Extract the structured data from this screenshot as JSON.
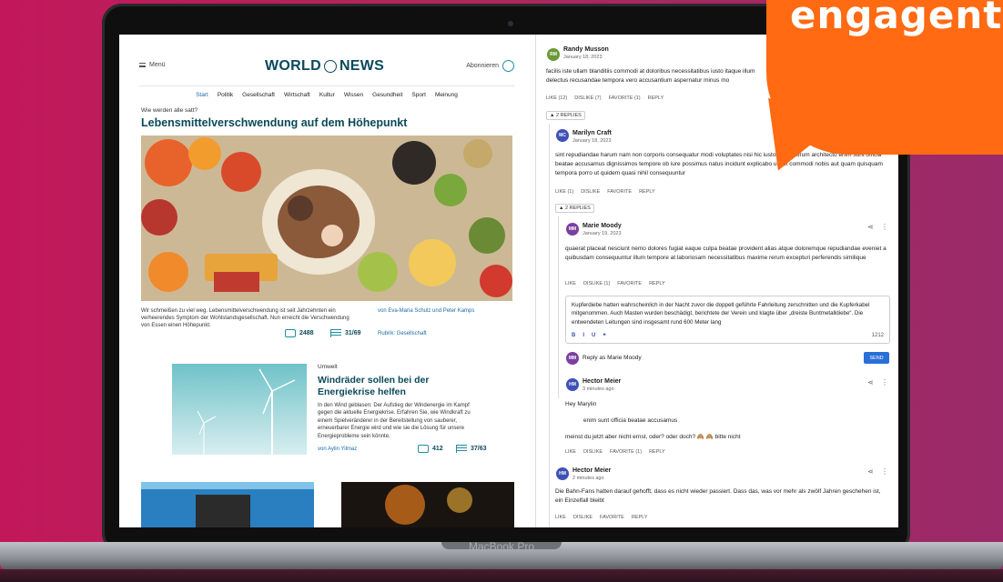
{
  "brand": {
    "bubble_text": "engagent",
    "device": "MacBook Pro",
    "accent": "#ff6a13"
  },
  "news": {
    "menu": "Menü",
    "logo_left": "WORLD",
    "logo_right": "NEWS",
    "subscribe": "Abonnieren",
    "nav": [
      "Start",
      "Politik",
      "Gesellschaft",
      "Wirtschaft",
      "Kultur",
      "Wissen",
      "Gesundheit",
      "Sport",
      "Meinung"
    ],
    "lead": {
      "kicker": "Wie werden alle satt?",
      "title": "Lebensmittelverschwendung auf dem Höhepunkt",
      "caption": "Wir schmeißen zu viel weg. Lebensmittelverschwendung ist seit Jahrzehnten ein verheerendes Symptom der Wohlstandsgesellschaft. Nun erreicht die Ver­schwendung von Essen einen Höhepunkt.",
      "authors": "von Eva-Maria Schulz und Peter Kamps",
      "rubric": "Rubrik: Gesellschaft",
      "comments": "2488",
      "reads": "31/69"
    },
    "second": {
      "kicker": "Umwelt",
      "title": "Windräder sollen bei der Energiekrise helfen",
      "text": "In den Wind geblasen: Der Aufstieg der Windenergie im Kampf gegen die aktuelle Energiekrise. Erfahren Sie, wie Windkraft zu einem Spielveränderer in der Bereitstellung von sauberer, erneuerbarer Energie wird und wie sie die Lösung für unsere Energieprobleme sein könnte.",
      "author": "von Aylin Yilmaz",
      "comments": "412",
      "reads": "37/63"
    }
  },
  "comments": {
    "c1": {
      "initials": "RM",
      "name": "Randy Musson",
      "date": "January 18, 2023",
      "text": "facilis iste ullam blanditiis commodi at doloribus necessitatibus iusto itaque illum delectus recusandae tempora vero accusantium aspernatur minus mo",
      "like": "LIKE (12)",
      "dislike": "DISLIKE (7)",
      "favorite": "FAVORITE (1)",
      "reply": "REPLY",
      "replies": "2 REPLIES"
    },
    "c2": {
      "initials": "MC",
      "name": "Marilyn Craft",
      "date": "January 18, 2023",
      "text": "sint repudiandae harum nam non corporis consequatur modi voluptates nisi hic iusto iste laborum architecto enim sunt officia beatae accusamus dignissimos tempore ob iure possimus natus incidunt explicabo ullam commodi nobis aut quam quisquam tempora porro ut quidem quasi nihil consequuntur",
      "like": "LIKE (1)",
      "dislike": "DISLIKE",
      "favorite": "FAVORITE",
      "reply": "REPLY",
      "replies": "2 REPLIES"
    },
    "c3": {
      "initials": "MM",
      "name": "Marie Moody",
      "date": "January 19, 2023",
      "text": "quaerat placeat nesciunt nemo dolores fugiat eaque culpa beatae provident alias atque doloremque repudiandae eveniet a quibusdam consequuntur illum tempore at laboriosam necessitatibus maxime rerum excepturi perferendis similique",
      "like": "LIKE",
      "dislike": "DISLIKE (1)",
      "favorite": "FAVORITE",
      "reply": "REPLY"
    },
    "editor": {
      "text": "Kupferdiebe hatten wahrscheinlich in der Nacht zuvor die doppelt geführte Fahrleitung zerschnitten und die Kupferkabel mitgenommen. Auch Masten wurden beschädigt, berichtete der Verein und klagte über „dreiste Buntmetalldiebe“. Die entwendeten Leitungen sind insgesamt rund 600 Meter lang",
      "tools": [
        "B",
        "I",
        "U",
        "❝"
      ],
      "count": "1212",
      "reply_as": "Reply as Marie Moody",
      "send": "SEND"
    },
    "c4": {
      "initials": "HM",
      "name": "Hector Meier",
      "date": "3 minutes ago",
      "line1": "Hey Marylin",
      "quote": "enim sunt officia beatae accusamus",
      "line2": "meinst du jetzt aber nicht ernst, oder? oder doch? 🙈 🙈 bitte nicht",
      "like": "LIKE",
      "dislike": "DISLIKE",
      "favorite": "FAVORITE (1)",
      "reply": "REPLY"
    },
    "c5": {
      "initials": "HM",
      "name": "Hector Meier",
      "date": "2 minutes ago",
      "text": "Die Bahn-Fans hatten darauf gehofft, dass es nicht wieder passiert. Dass das, was vor mehr als zwölf Jahren geschehen ist, ein Einzelfall bleibt",
      "like": "LIKE",
      "dislike": "DISLIKE",
      "favorite": "FAVORITE",
      "reply": "REPLY"
    }
  }
}
